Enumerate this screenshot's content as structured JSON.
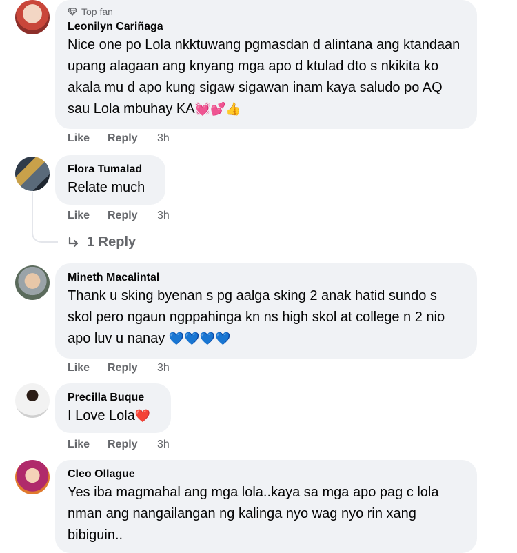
{
  "comments": [
    {
      "badge": "Top fan",
      "author": "Leonilyn Cariñaga",
      "text": "Nice one po Lola nkktuwang pgmasdan d alintana ang ktandaan upang alagaan ang knyang mga apo d ktulad dto s nkikita ko akala mu d apo kung sigaw sigawan inam kaya saludo po AQ sau Lola mbuhay KA",
      "emojis": "💓💕👍",
      "like": "Like",
      "reply": "Reply",
      "time": "3h"
    },
    {
      "author": "Flora Tumalad",
      "text": "Relate much",
      "like": "Like",
      "reply": "Reply",
      "time": "3h",
      "replies_label": "1 Reply"
    },
    {
      "author": "Mineth Macalintal",
      "text": "Thank u sking byenan s pg aalga sking 2 anak hatid sundo s skol pero ngaun ngppahinga kn ns high skol at college n 2 nio apo luv u nanay",
      "emojis": "💙💙💙💙",
      "like": "Like",
      "reply": "Reply",
      "time": "3h"
    },
    {
      "author": "Precilla Buque",
      "text": "I Love Lola",
      "emojis": "❤️",
      "like": "Like",
      "reply": "Reply",
      "time": "3h"
    },
    {
      "author": "Cleo Ollague",
      "text": "Yes iba magmahal ang mga lola..kaya sa mga apo pag c lola nman ang nangailangan ng kalinga nyo wag nyo rin xang bibiguin.."
    }
  ],
  "colors": {
    "bubble": "#f0f2f5",
    "secondary_text": "#65676b",
    "primary_text": "#050505"
  }
}
